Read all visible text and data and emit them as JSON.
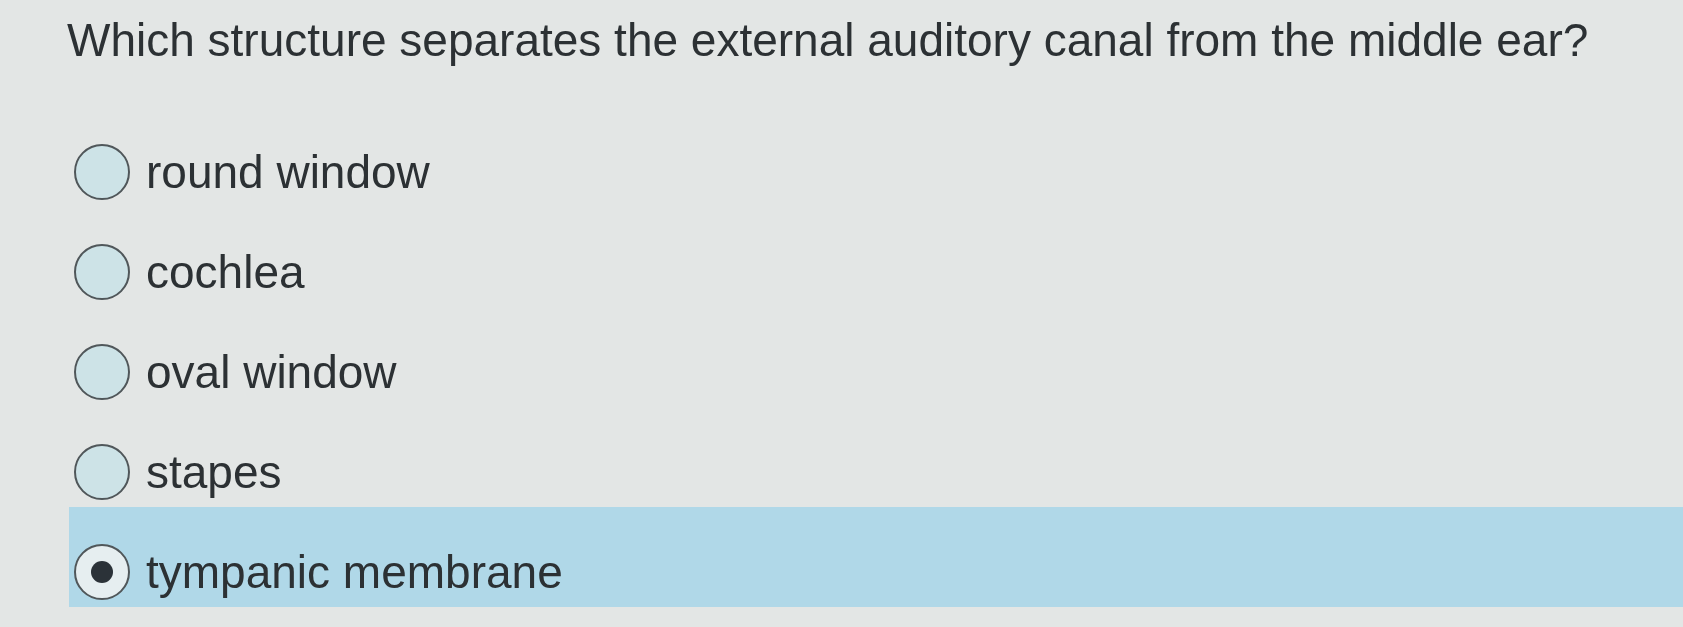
{
  "question": "Which structure separates the external auditory canal from the middle ear?",
  "options": [
    {
      "label": "round window",
      "selected": false
    },
    {
      "label": "cochlea",
      "selected": false
    },
    {
      "label": "oval window",
      "selected": false
    },
    {
      "label": "stapes",
      "selected": false
    },
    {
      "label": "tympanic membrane",
      "selected": true
    }
  ]
}
